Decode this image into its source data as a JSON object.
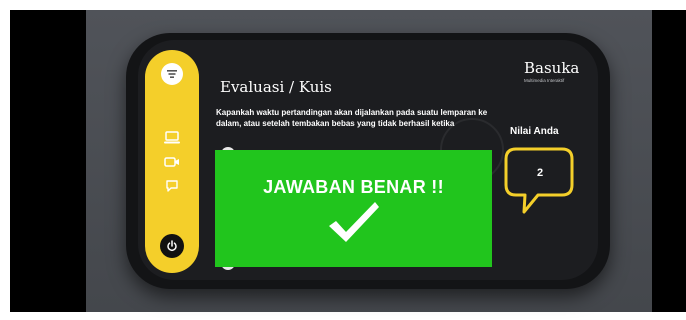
{
  "page": {
    "title": "Evaluasi / Kuis",
    "brand": {
      "name": "Basuka",
      "subtitle": "Multimedia Interaktif"
    }
  },
  "question": {
    "text": "Kapankah waktu pertandingan akan dijalankan pada suatu lemparan ke dalam, atau setelah tembakan bebas yang tidak berhasil ketika"
  },
  "score": {
    "label": "Nilai Anda",
    "value": "2"
  },
  "feedback": {
    "message": "JAWABAN BENAR !!"
  },
  "sidebar": {
    "items": [
      {
        "icon": "menu-icon"
      },
      {
        "icon": "laptop-icon"
      },
      {
        "icon": "video-icon"
      },
      {
        "icon": "chat-icon"
      },
      {
        "icon": "power-icon"
      }
    ]
  },
  "colors": {
    "sidebar": "#f4cf2a",
    "accent": "#f4cf2a",
    "correct": "#21c51d",
    "device": "#131416",
    "screen": "#1c1d20"
  }
}
